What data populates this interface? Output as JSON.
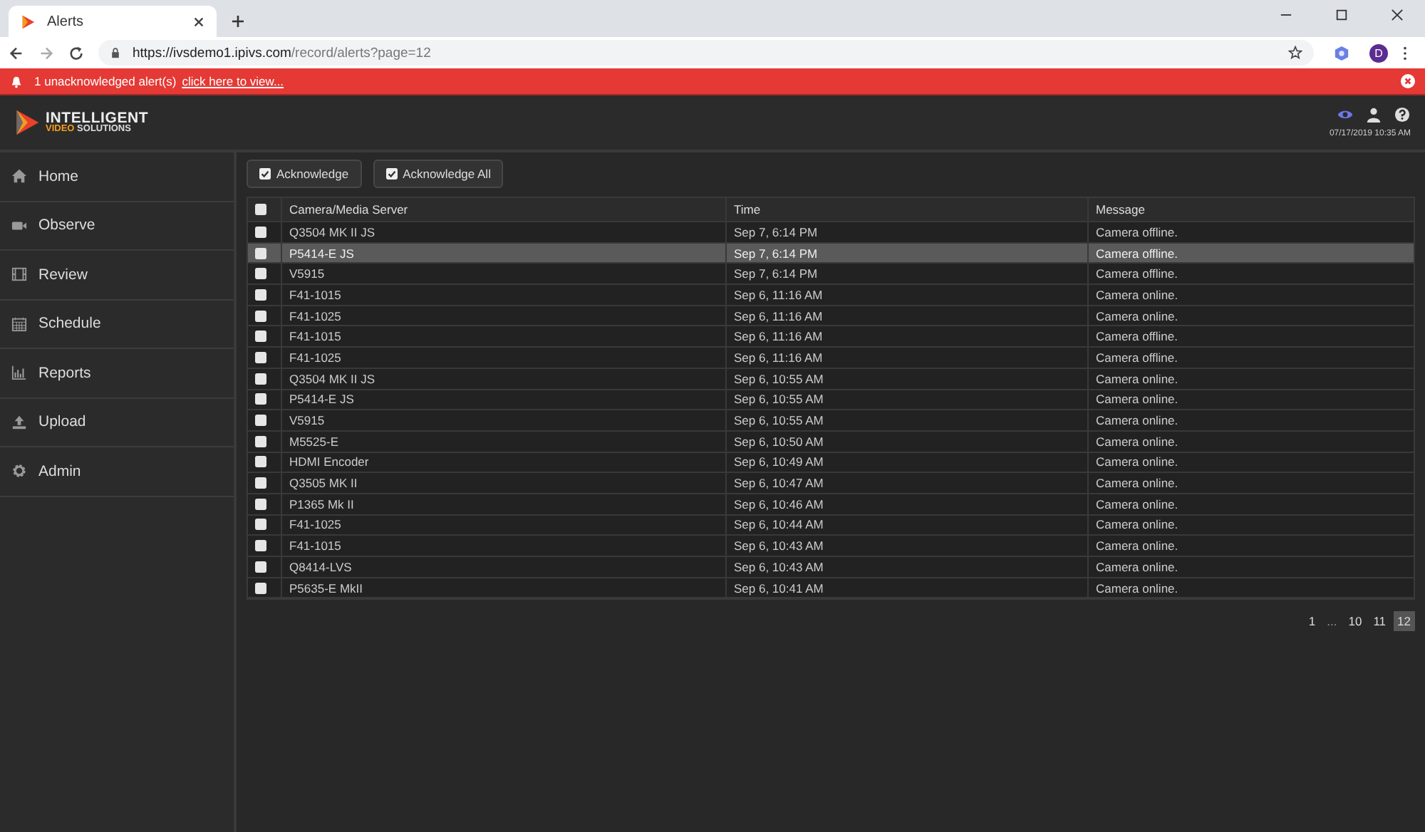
{
  "browser": {
    "tab_title": "Alerts",
    "url_host": "https://ivsdemo1.ipivs.com",
    "url_path": "/record/alerts?page=12",
    "profile_initial": "D"
  },
  "alert_bar": {
    "text": "1 unacknowledged alert(s)",
    "link": "click here to view..."
  },
  "header": {
    "logo_top": "INTELLIGENT",
    "logo_accent": "VIDEO",
    "logo_rest": "SOLUTIONS",
    "datetime": "07/17/2019 10:35 AM"
  },
  "sidebar": {
    "items": [
      {
        "label": "Home"
      },
      {
        "label": "Observe"
      },
      {
        "label": "Review"
      },
      {
        "label": "Schedule"
      },
      {
        "label": "Reports"
      },
      {
        "label": "Upload"
      },
      {
        "label": "Admin"
      }
    ]
  },
  "toolbar": {
    "buttons": [
      "Acknowledge",
      "Acknowledge All"
    ]
  },
  "table": {
    "columns": [
      "Camera/Media Server",
      "Time",
      "Message"
    ],
    "all_checked": false,
    "rows": [
      {
        "camera": "Q3504 MK II JS",
        "time": "Sep 7, 6:14 PM",
        "message": "Camera offline.",
        "checked": false,
        "selected": false
      },
      {
        "camera": "P5414-E JS",
        "time": "Sep 7, 6:14 PM",
        "message": "Camera offline.",
        "checked": false,
        "selected": true
      },
      {
        "camera": "V5915",
        "time": "Sep 7, 6:14 PM",
        "message": "Camera offline.",
        "checked": false,
        "selected": false
      },
      {
        "camera": "F41-1015",
        "time": "Sep 6, 11:16 AM",
        "message": "Camera online.",
        "checked": false,
        "selected": false
      },
      {
        "camera": "F41-1025",
        "time": "Sep 6, 11:16 AM",
        "message": "Camera online.",
        "checked": false,
        "selected": false
      },
      {
        "camera": "F41-1015",
        "time": "Sep 6, 11:16 AM",
        "message": "Camera offline.",
        "checked": false,
        "selected": false
      },
      {
        "camera": "F41-1025",
        "time": "Sep 6, 11:16 AM",
        "message": "Camera offline.",
        "checked": false,
        "selected": false
      },
      {
        "camera": "Q3504 MK II JS",
        "time": "Sep 6, 10:55 AM",
        "message": "Camera online.",
        "checked": false,
        "selected": false
      },
      {
        "camera": "P5414-E JS",
        "time": "Sep 6, 10:55 AM",
        "message": "Camera online.",
        "checked": false,
        "selected": false
      },
      {
        "camera": "V5915",
        "time": "Sep 6, 10:55 AM",
        "message": "Camera online.",
        "checked": false,
        "selected": false
      },
      {
        "camera": "M5525-E",
        "time": "Sep 6, 10:50 AM",
        "message": "Camera online.",
        "checked": false,
        "selected": false
      },
      {
        "camera": "HDMI Encoder",
        "time": "Sep 6, 10:49 AM",
        "message": "Camera online.",
        "checked": false,
        "selected": false
      },
      {
        "camera": "Q3505 MK II",
        "time": "Sep 6, 10:47 AM",
        "message": "Camera online.",
        "checked": false,
        "selected": false
      },
      {
        "camera": "P1365 Mk II",
        "time": "Sep 6, 10:46 AM",
        "message": "Camera online.",
        "checked": false,
        "selected": false
      },
      {
        "camera": "F41-1025",
        "time": "Sep 6, 10:44 AM",
        "message": "Camera online.",
        "checked": false,
        "selected": false
      },
      {
        "camera": "F41-1015",
        "time": "Sep 6, 10:43 AM",
        "message": "Camera online.",
        "checked": false,
        "selected": false
      },
      {
        "camera": "Q8414-LVS",
        "time": "Sep 6, 10:43 AM",
        "message": "Camera online.",
        "checked": false,
        "selected": false
      },
      {
        "camera": "P5635-E MkII",
        "time": "Sep 6, 10:41 AM",
        "message": "Camera online.",
        "checked": false,
        "selected": false
      }
    ]
  },
  "pagination": [
    {
      "label": "1",
      "kind": "page",
      "selected": false
    },
    {
      "label": "...",
      "kind": "gap",
      "selected": false
    },
    {
      "label": "10",
      "kind": "page",
      "selected": false
    },
    {
      "label": "11",
      "kind": "page",
      "selected": false
    },
    {
      "label": "12",
      "kind": "page",
      "selected": true
    }
  ]
}
